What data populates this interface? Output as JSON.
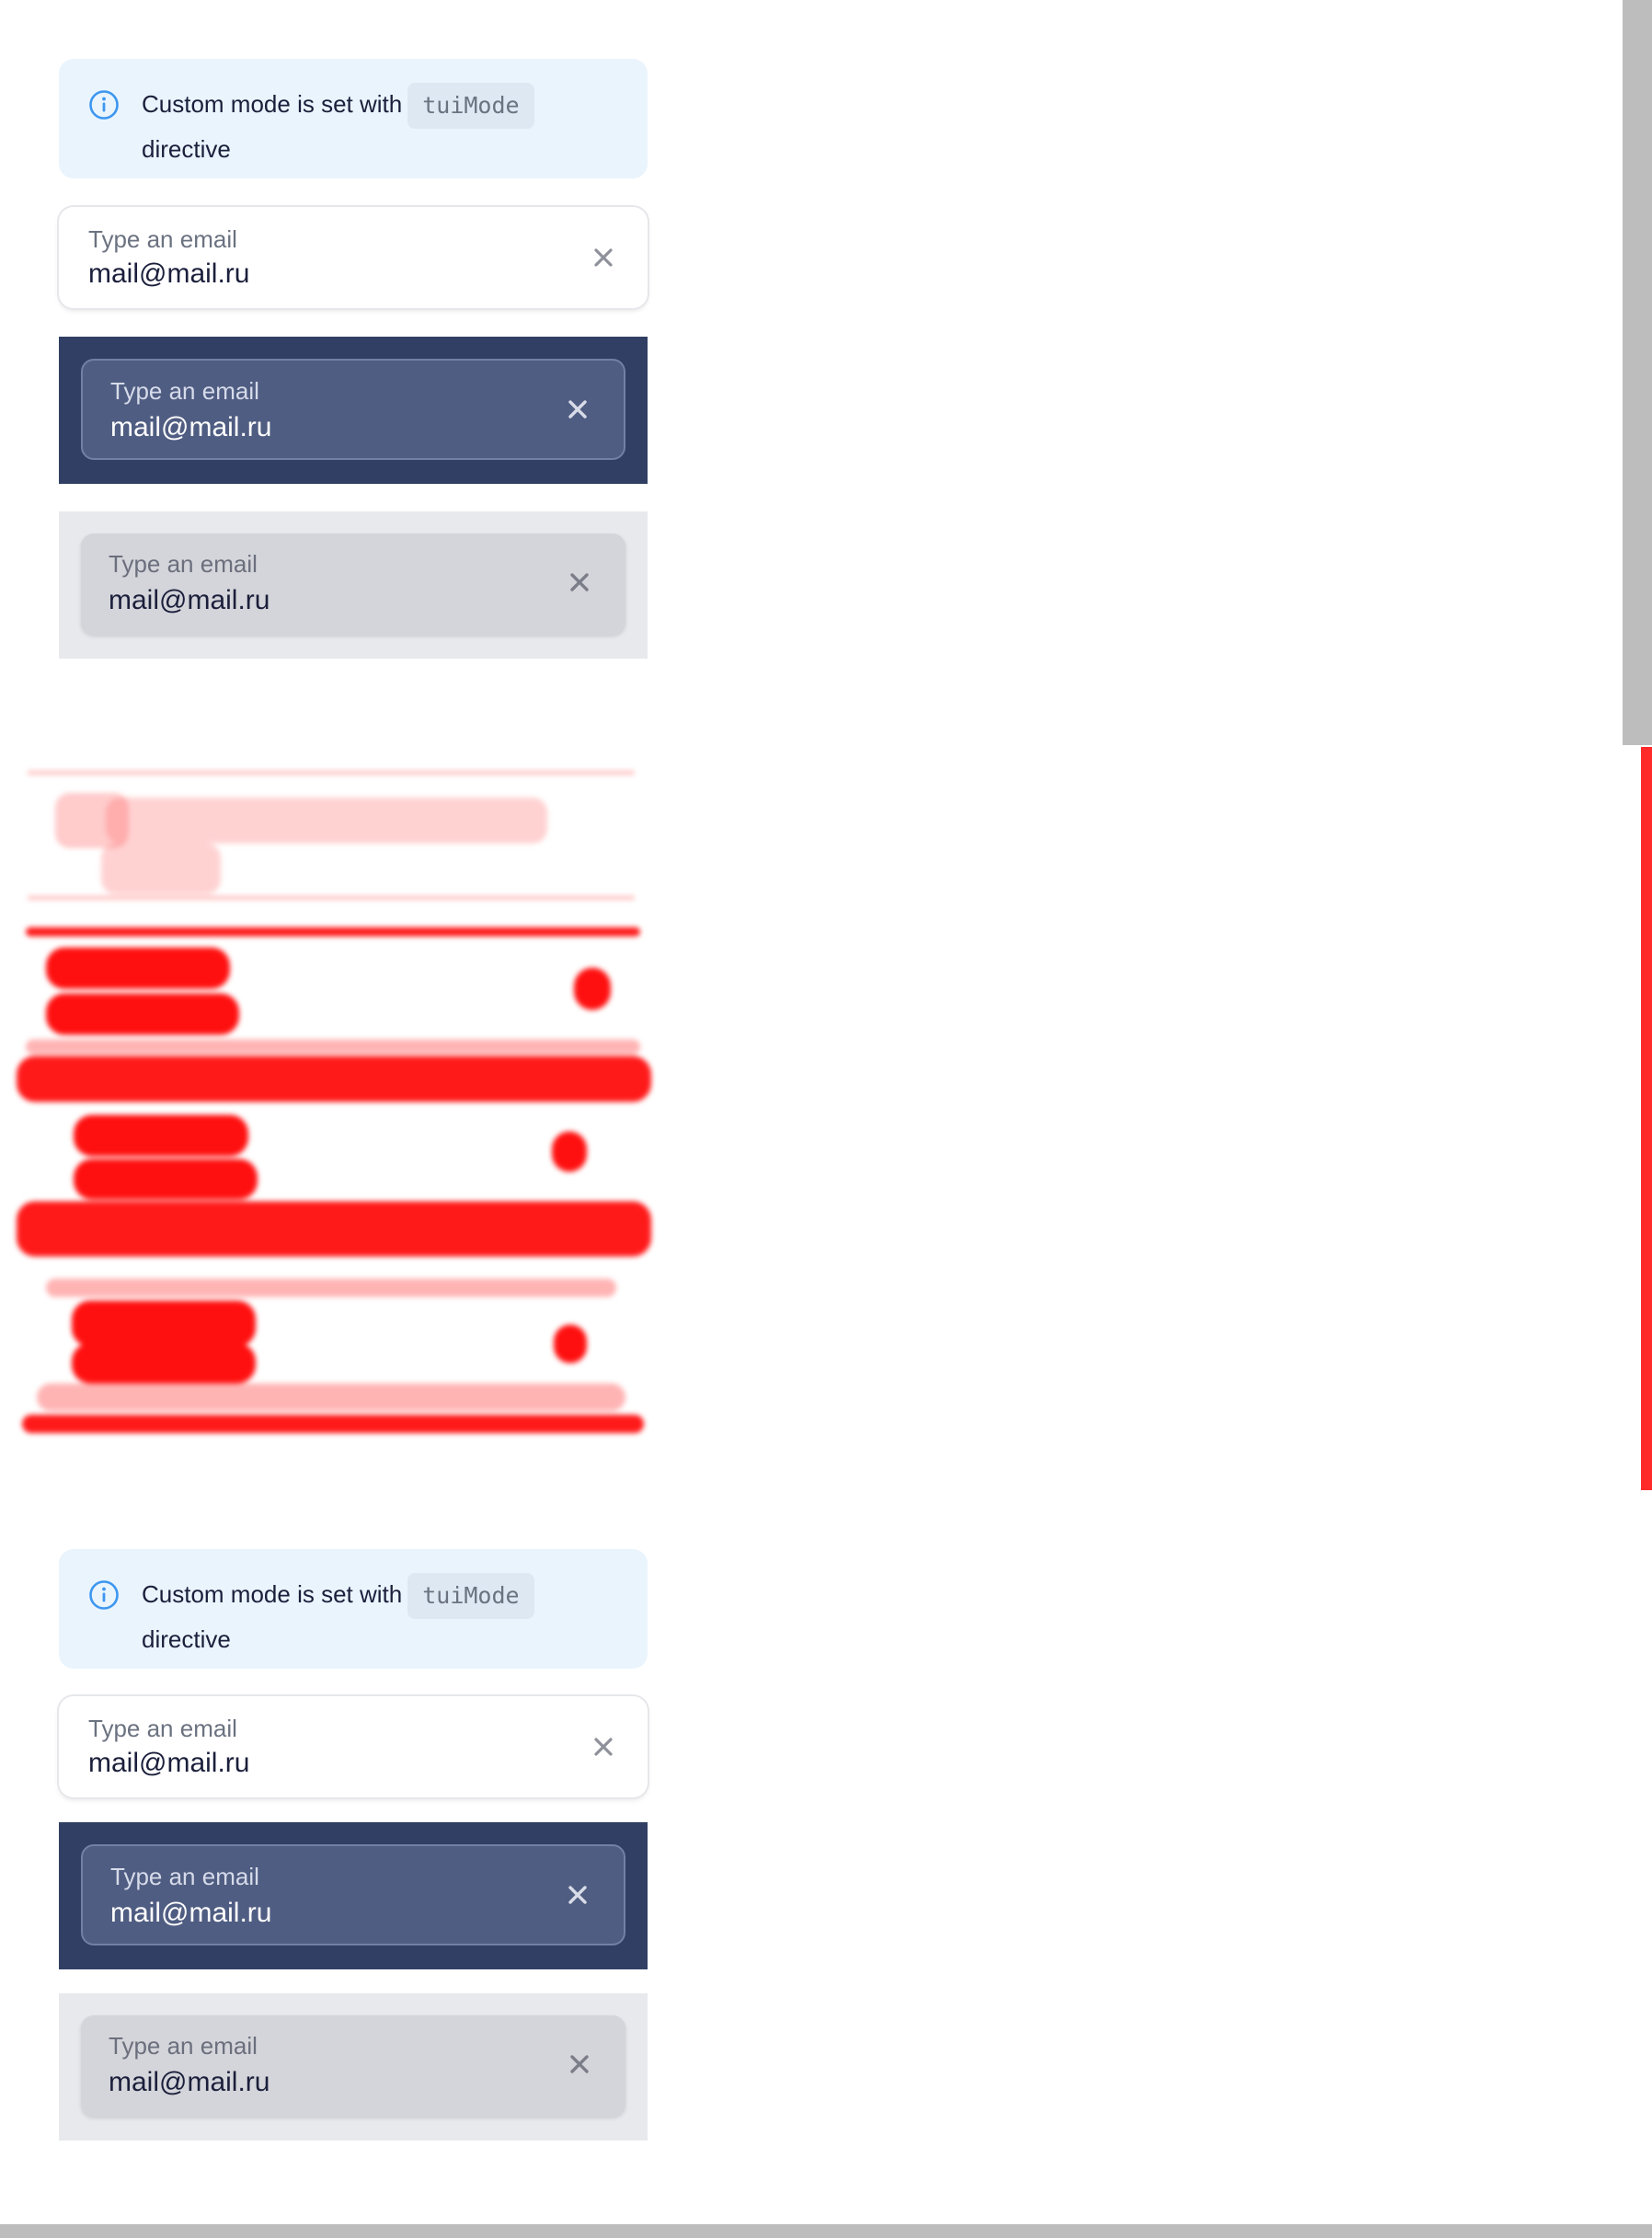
{
  "notice": {
    "text": "Custom mode is set with",
    "code": "tuiMode",
    "text_after": "directive"
  },
  "fields": {
    "label": "Type an email",
    "value": "mail@mail.ru"
  },
  "colors": {
    "notice_bg": "#eaf4fd",
    "info_icon": "#3d97f0",
    "dark_panel": "#303f63",
    "dark_field": "#505d82",
    "grey_panel": "#e8e9ed",
    "grey_field": "#d4d5da",
    "diff_red": "#ff1a1a"
  },
  "icons": {
    "info": "info-icon",
    "clear": "close-icon"
  }
}
